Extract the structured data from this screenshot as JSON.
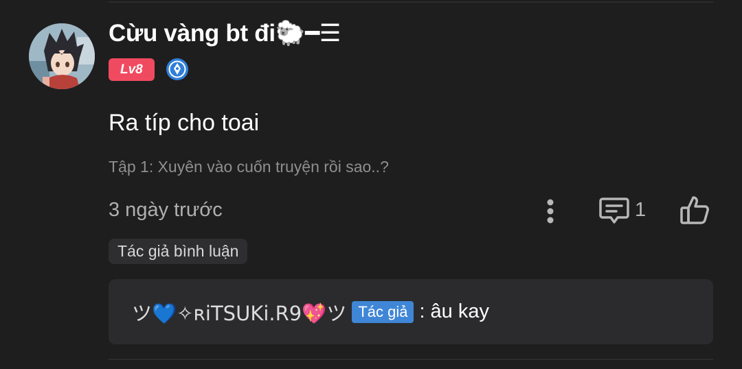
{
  "comment": {
    "username": "Cừu vàng bt đi🐑━☰",
    "level_badge": "Lv8",
    "text": "Ra típ cho toai",
    "chapter": "Tập 1: Xuyên vào cuốn truyện rồi sao..?",
    "time": "3 ngày trước",
    "reply_count": "1",
    "author_tag": "Tác giả bình luận",
    "icons": {
      "more": "more-vertical-icon",
      "reply": "comment-icon",
      "like": "thumbs-up-icon",
      "verified": "verified-pen-icon"
    },
    "colors": {
      "level_badge": "#f04a60",
      "role_badge": "#3f86d6",
      "verified": "#2f7fd8"
    }
  },
  "reply": {
    "author": "ツ💙✧ʀiTSUKi.R9💖ツ",
    "role_badge": "Tác giả",
    "separator": ":",
    "text": "âu kay"
  }
}
